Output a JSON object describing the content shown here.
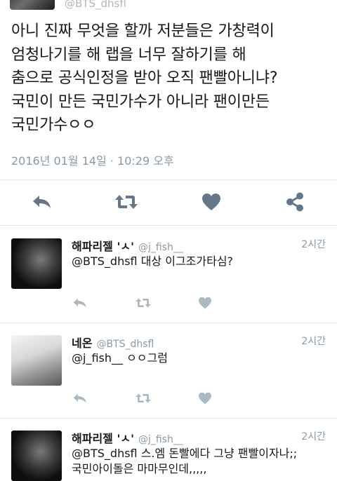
{
  "top": {
    "handle": "@BTS_dhsfl"
  },
  "main_tweet": {
    "text_lines": [
      "아니 진짜 무엇을 할까 저분들은 가창력이",
      "엄청나기를 해 랩을 너무 잘하기를 해",
      "춤으로 공식인정을 받아 오직 팬빨아니냐?",
      "국민이 만든 국민가수가 아니라 팬이만든",
      "국민가수ㅇㅇ"
    ],
    "timestamp": "2016년 01월 14일 · 10:29 오후"
  },
  "replies": [
    {
      "name": "해파리젤 'ㅅ'",
      "handle": "@j_fish__",
      "time": "2시간",
      "text_lines": [
        "@BTS_dhsfl 대상 이그조가타심?"
      ]
    },
    {
      "name": "네온",
      "handle": "@BTS_dhsfl",
      "time": "2시간",
      "text_lines": [
        "@j_fish__ ㅇㅇ그럼"
      ]
    },
    {
      "name": "해파리젤 'ㅅ'",
      "handle": "@j_fish__",
      "time": "2시간",
      "text_lines": [
        "@BTS_dhsfl 스.엠 돈빨에다 그냥 팬빨이자나;;",
        "국민아이돌은 마마무인데,,,,,"
      ]
    }
  ],
  "icons": {
    "reply": "reply-icon",
    "retweet": "retweet-icon",
    "like": "heart-icon",
    "share": "share-icon"
  },
  "colors": {
    "main_icon": "#657786",
    "reply_icon": "#aab8c2",
    "muted_text": "#8899a6",
    "divider": "#e1e8ed"
  }
}
